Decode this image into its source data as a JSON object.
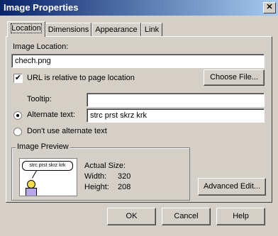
{
  "window": {
    "title": "Image Properties",
    "close_glyph": "✕"
  },
  "tabs": [
    {
      "label": "Location",
      "active": true
    },
    {
      "label": "Dimensions",
      "active": false
    },
    {
      "label": "Appearance",
      "active": false
    },
    {
      "label": "Link",
      "active": false
    }
  ],
  "location": {
    "image_location_label": "Image Location:",
    "image_location_value": "chech.png",
    "relative_checkbox_label": "URL is relative to page location",
    "relative_checked": true,
    "choose_file_button": "Choose File...",
    "tooltip_label": "Tooltip:",
    "tooltip_value": "",
    "alt_text_label": "Alternate text:",
    "alt_text_value": "strc prst skrz krk",
    "no_alt_label": "Don't use alternate text",
    "selected_radio": "alternate_text"
  },
  "preview": {
    "group_label": "Image Preview",
    "bubble_text": "strc prst skrz krk",
    "actual_size_label": "Actual Size:",
    "width_label": "Width:",
    "width_value": "320",
    "height_label": "Height:",
    "height_value": "208",
    "advanced_edit_button": "Advanced Edit..."
  },
  "buttons": {
    "ok": "OK",
    "cancel": "Cancel",
    "help": "Help"
  }
}
